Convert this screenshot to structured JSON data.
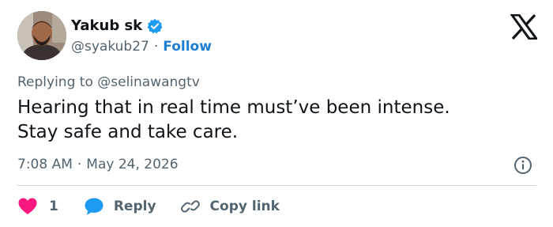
{
  "tweet": {
    "author": {
      "name": "Yakub sk",
      "handle": "@syakub27",
      "separator": "·",
      "follow_label": "Follow",
      "avatar_icon": "avatar-photo",
      "verified_icon": "verified-badge-icon"
    },
    "brand_icon": "x-logo-icon",
    "replying_to": {
      "prefix": "Replying to",
      "mention": "@selinawangtv"
    },
    "text_lines": [
      "Hearing that in real time must’ve been intense.",
      "Stay safe and take care."
    ],
    "time": "7:08 AM",
    "date_separator": "·",
    "date": "May 24, 2026",
    "info_icon": "info-icon",
    "actions": {
      "like_count": "1",
      "reply_label": "Reply",
      "copy_link_label": "Copy link"
    }
  },
  "colors": {
    "text": "#0f1419",
    "secondary": "#536471",
    "accent": "#1d9bf0",
    "follow": "#1d7fd1",
    "like": "#f91880",
    "divider": "#cfd9de"
  }
}
